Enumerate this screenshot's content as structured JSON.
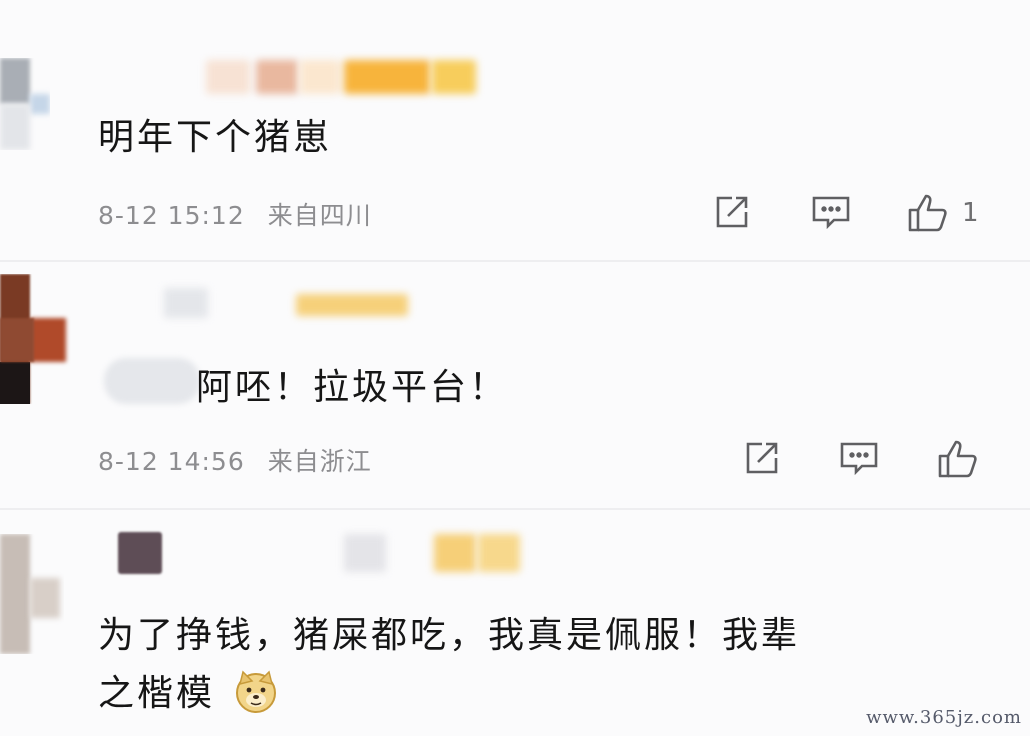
{
  "comments": [
    {
      "text": "明年下个猪崽",
      "date": "8-12 15:12",
      "location": "来自四川",
      "likes": "1"
    },
    {
      "text": "阿呸！拉圾平台！",
      "date": "8-12 14:56",
      "location": "来自浙江",
      "likes": ""
    },
    {
      "text_line1": "为了挣钱，猪屎都吃，我真是佩服！我辈",
      "text_line2": "之楷模"
    }
  ],
  "icons": [
    "share-icon",
    "comment-icon",
    "like-icon",
    "doge-emoji-icon"
  ],
  "watermark": "www.365jz.com",
  "colors": {
    "background": "#fbfbfc",
    "meta_text": "#8d8d90",
    "icon_stroke": "#5f5f62"
  }
}
